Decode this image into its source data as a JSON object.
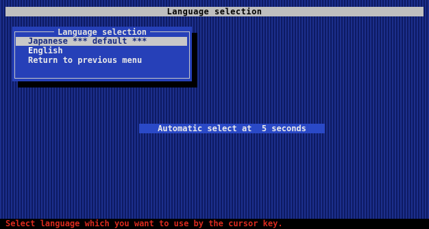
{
  "title_bar": {
    "text": "Language selection"
  },
  "menu": {
    "title": "Language selection",
    "items": [
      {
        "hotkey": "J",
        "rest": "apanese *** default ***",
        "selected": true
      },
      {
        "hotkey": "E",
        "rest": "nglish",
        "selected": false
      },
      {
        "hotkey": "",
        "rest": "Return to previous menu",
        "selected": false
      }
    ]
  },
  "countdown": {
    "text": "Automatic select at  5 seconds"
  },
  "status_bar": {
    "text": "Select language which you want to use by the cursor key."
  },
  "colors": {
    "background_blue": "#1c2f8c",
    "menu_blue": "#2640b8",
    "selection_gray": "#c8c8c8",
    "status_red": "#d92a1e"
  }
}
